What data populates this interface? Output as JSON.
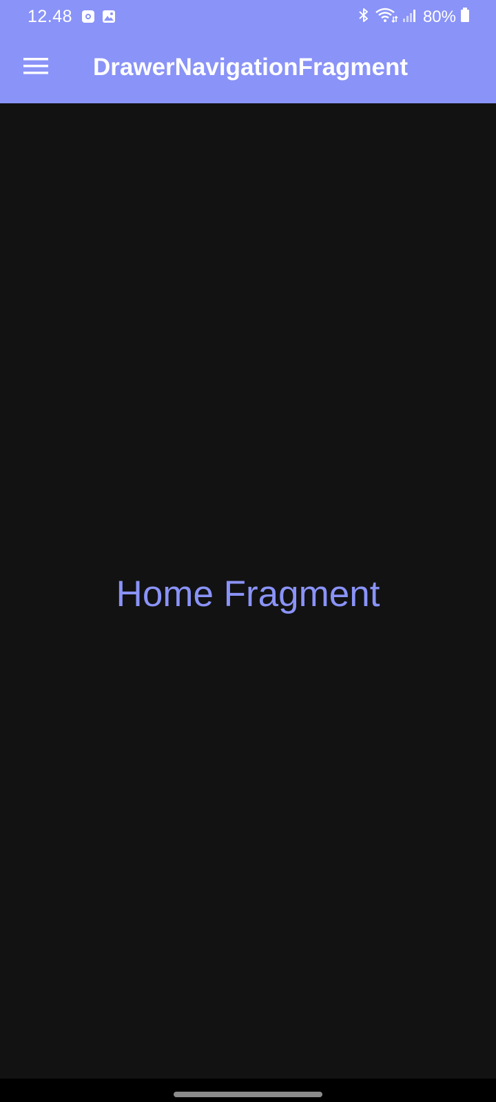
{
  "status_bar": {
    "time": "12.48",
    "battery": "80%",
    "icons": [
      "screen-record-icon",
      "gallery-icon",
      "bluetooth-icon",
      "wifi-icon",
      "signal-icon",
      "battery-icon"
    ]
  },
  "app_bar": {
    "title": "DrawerNavigationFragment",
    "menu_icon": "hamburger-menu-icon"
  },
  "content": {
    "text": "Home Fragment"
  },
  "colors": {
    "app_bar": "#8a93f7",
    "background": "#121212",
    "accent_text": "#8a93f7"
  }
}
